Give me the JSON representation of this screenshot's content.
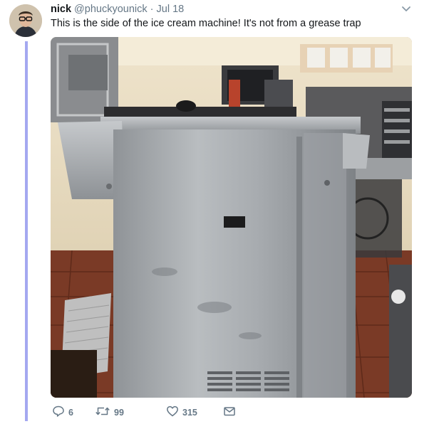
{
  "tweet": {
    "author_name": "nick",
    "author_handle": "@phuckyounick",
    "separator": "·",
    "date": "Jul 18",
    "text": "This is the side of the ice cream machine! It's not from a grease trap"
  },
  "actions": {
    "replies": "6",
    "retweets": "99",
    "likes": "315"
  },
  "icons": {
    "reply": "reply-icon",
    "retweet": "retweet-icon",
    "like": "heart-icon",
    "dm": "envelope-icon",
    "menu": "chevron-down-icon"
  },
  "colors": {
    "thread_line": "#a4a8f0",
    "secondary_text": "#657786",
    "primary_text": "#14171a"
  }
}
